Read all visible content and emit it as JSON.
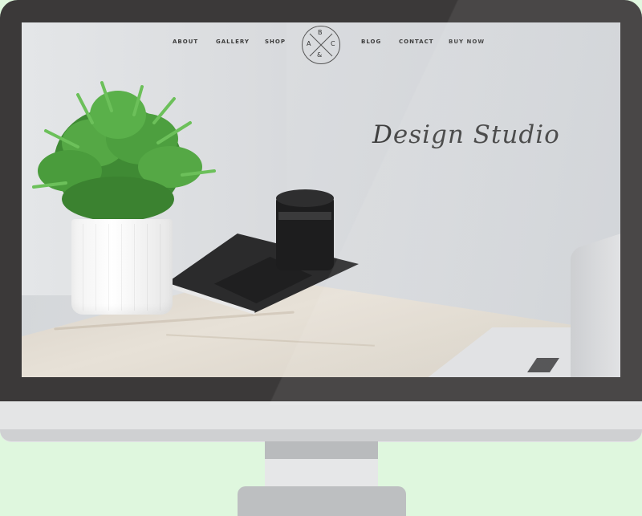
{
  "nav": {
    "left": [
      "ABOUT",
      "GALLERY",
      "SHOP"
    ],
    "right": [
      "BLOG",
      "CONTACT",
      "BUY NOW"
    ]
  },
  "logo": {
    "top": "B",
    "left": "A",
    "right": "C",
    "bottom": "&"
  },
  "hero": {
    "title": "Design Studio"
  },
  "colors": {
    "background": "#dff7de",
    "bezel": "#3b3939",
    "text": "#3c3c3c"
  }
}
